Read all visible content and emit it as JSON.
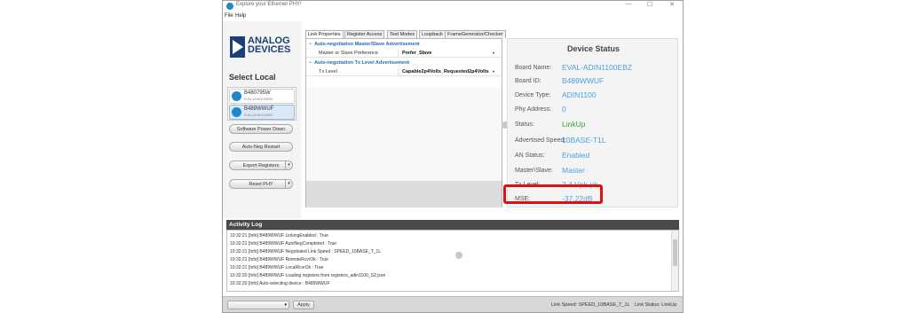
{
  "window": {
    "title": "Explore your Ethernet PHY!",
    "minimize_label": "—",
    "maximize_label": "☐",
    "close_label": "✕"
  },
  "menu": [
    "File",
    "Help"
  ],
  "logo": {
    "line1": "ANALOG",
    "line2": "DEVICES"
  },
  "select_local": "Select Local",
  "devices": [
    {
      "name": "B480795W",
      "sub": "EVAL-ADIN1100EBZ",
      "selected": false
    },
    {
      "name": "B489WWUF",
      "sub": "EVAL-ADIN1100EBZ",
      "selected": true
    }
  ],
  "buttons": {
    "software_power_down": "Software Power Down",
    "auto_neg_restart": "Auto-Neg Restart",
    "export_registers": "Export Registers",
    "reset_phy": "Reset PHY",
    "split_arrow": "▾"
  },
  "tabs": [
    "Link Properties",
    "Register Access",
    "Test Modes",
    "Loopback",
    "FrameGenerator/Checker"
  ],
  "property_grid": {
    "sections": [
      {
        "title": "Auto-negotiation Master/Slave Advertisement",
        "rows": [
          {
            "label": "Master or Slave Preference",
            "value": "Prefer_Slave"
          }
        ]
      },
      {
        "title": "Auto-negotiation Tx Level Advertisement",
        "rows": [
          {
            "label": "Tx Level",
            "value": "Capable2p4Volts_Requested2p4Volts"
          }
        ]
      }
    ],
    "dropdown_glyph": "▾",
    "collapse_glyph": "−"
  },
  "device_status": {
    "title": "Device Status",
    "items": [
      {
        "label": "Board Name:",
        "value": "EVAL-ADIN1100EBZ"
      },
      {
        "label": "Board ID:",
        "value": "B489WWUF"
      },
      {
        "label": "Device Type:",
        "value": "ADIN1100"
      },
      {
        "label": "Phy Address:",
        "value": "0"
      },
      {
        "label": "Status:",
        "value": "LinkUp"
      },
      {
        "label": "Advertised Speed:",
        "value": "10BASE-T1L"
      },
      {
        "label": "AN Status:",
        "value": "Enabled"
      },
      {
        "label": "Master\\Slave:",
        "value": "Master"
      },
      {
        "label": "Tx Level:",
        "value": "2.4 Vpk-pk"
      },
      {
        "label": "MSE:",
        "value": "-37.22dB"
      }
    ]
  },
  "activity_log": {
    "title": "Activity Log",
    "lines": [
      "10:32:21 [Info] B489WWUF LinkingEnabled : True",
      "10:32:21 [Info] B489WWUF AutoNegCompleted : True",
      "10:32:21 [Info] B489WWUF Negotiated Link Speed : SPEED_10BASE_T_1L",
      "10:32:21 [Info] B489WWUF RemoteRcvrOk : True",
      "10:32:21 [Info] B489WWUF LocalRcvrOk : True",
      "10:32:20 [Info] B489WWUF Loading registers from registers_adin1100_S2.json",
      "10:32:20 [Info] Auto-selecting device : B489WWUF"
    ]
  },
  "status_bar": {
    "apply": "Apply",
    "link_speed": "Link Speed: SPEED_10BASE_T_1L",
    "link_status": "Link Status: LinkUp"
  },
  "colors": {
    "accent_blue": "#4aa3df",
    "link_green": "#3aa530",
    "highlight_red": "#e01010",
    "logo_navy": "#1c3f78"
  }
}
